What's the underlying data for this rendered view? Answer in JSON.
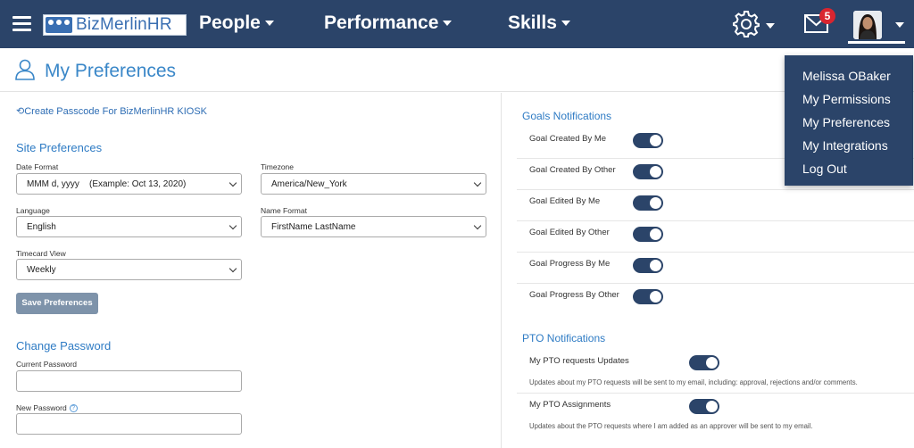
{
  "header": {
    "logo_text": "BizMerlinHR",
    "nav": [
      {
        "label": "People"
      },
      {
        "label": "Performance"
      },
      {
        "label": "Skills"
      }
    ],
    "mail_count": "5",
    "accent": "#2b4469"
  },
  "page": {
    "title": "My Preferences",
    "kiosk_link": "Create Passcode For BizMerlinHR KIOSK"
  },
  "site_preferences": {
    "title": "Site Preferences",
    "date_format": {
      "label": "Date Format",
      "value": "MMM d, yyyy    (Example: Oct 13, 2020)"
    },
    "timezone": {
      "label": "Timezone",
      "value": "America/New_York"
    },
    "language": {
      "label": "Language",
      "value": "English"
    },
    "name_format": {
      "label": "Name Format",
      "value": "FirstName LastName"
    },
    "timecard_view": {
      "label": "Timecard View",
      "value": "Weekly"
    },
    "save_label": "Save Preferences"
  },
  "change_password": {
    "title": "Change Password",
    "current_label": "Current Password",
    "new_label": "New Password",
    "help_glyph": "?"
  },
  "goals_notifications": {
    "title": "Goals Notifications",
    "items": [
      {
        "label": "Goal Created By Me",
        "enabled": true
      },
      {
        "label": "Goal Created By Other",
        "enabled": true
      },
      {
        "label": "Goal Edited By Me",
        "enabled": true
      },
      {
        "label": "Goal Edited By Other",
        "enabled": true
      },
      {
        "label": "Goal Progress By Me",
        "enabled": true
      },
      {
        "label": "Goal Progress By Other",
        "enabled": true
      }
    ]
  },
  "pto_notifications": {
    "title": "PTO Notifications",
    "items": [
      {
        "label": "My PTO requests Updates",
        "description": "Updates about my PTO requests will be sent to my email, including: approval, rejections and/or comments.",
        "enabled": true
      },
      {
        "label": "My PTO Assignments",
        "description": "Updates about the PTO requests where I am added as an approver will be sent to my email.",
        "enabled": true
      }
    ]
  },
  "user_menu": {
    "items": [
      {
        "label": "Melissa OBaker"
      },
      {
        "label": "My Permissions"
      },
      {
        "label": "My Preferences"
      },
      {
        "label": "My Integrations"
      },
      {
        "label": "Log Out"
      }
    ]
  }
}
